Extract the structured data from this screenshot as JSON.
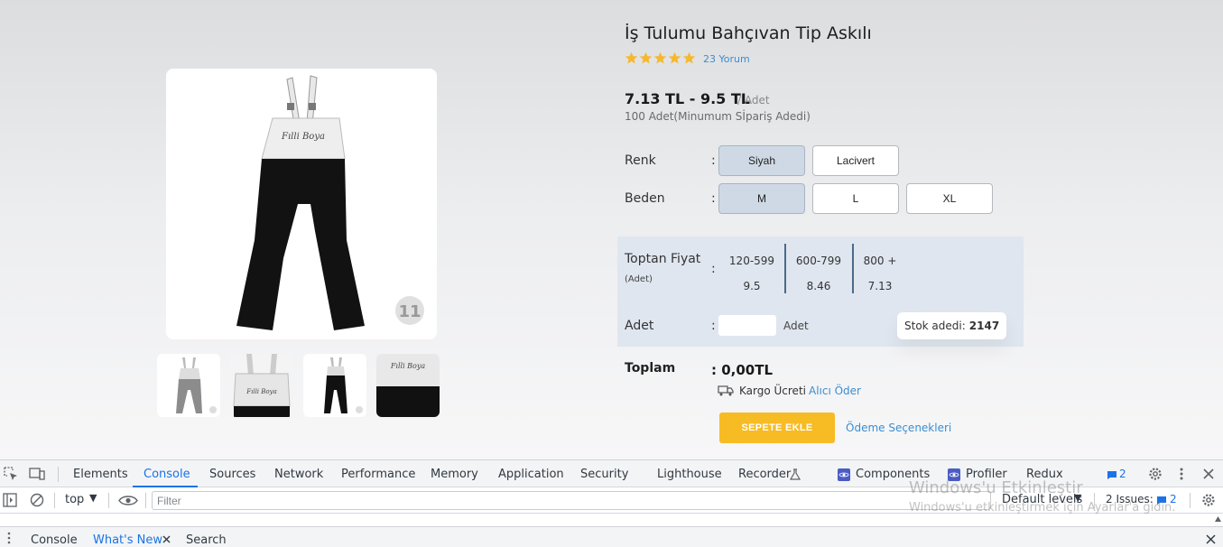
{
  "product": {
    "title": "İş Tulumu Bahçıvan Tip Askılı",
    "rating": 5,
    "review_text": "23 Yorum",
    "price_range": "7.13 TL - 9.5 TL",
    "price_unit": "/ Adet",
    "min_order": "100 Adet(Minumum Sİpariş Adedi)",
    "image_brand": "Fılli Boya",
    "image_badge": "11"
  },
  "options": {
    "color_label": "Renk",
    "size_label": "Beden",
    "colon": ":",
    "colors": [
      "Siyah",
      "Lacivert"
    ],
    "selected_color": "Siyah",
    "sizes": [
      "M",
      "L",
      "XL"
    ],
    "selected_size": "M"
  },
  "wholesale": {
    "label": "Toptan Fiyat",
    "sub_label": "(Adet)",
    "tiers": [
      {
        "range": "120-599",
        "price": "9.5"
      },
      {
        "range": "600-799",
        "price": "8.46"
      },
      {
        "range": "800 +",
        "price": "7.13"
      }
    ]
  },
  "quantity": {
    "label": "Adet",
    "unit": "Adet",
    "value": "",
    "stock_label": "Stok adedi:",
    "stock_value": "2147"
  },
  "total": {
    "label": "Toplam",
    "value": ": 0,00TL",
    "cargo_label": "Kargo Ücreti",
    "cargo_link": "Alıcı Öder"
  },
  "actions": {
    "add_to_cart": "SEPETE EKLE",
    "payment_options": "Ödeme Seçenekleri"
  },
  "colors": {
    "accent": "#f7bb24",
    "link": "#3b8ed0",
    "selected_option": "#cfd9e6",
    "devtools_active": "#1a73e8"
  },
  "devtools": {
    "tabs": [
      "Elements",
      "Console",
      "Sources",
      "Network",
      "Performance",
      "Memory",
      "Application",
      "Security",
      "Lighthouse",
      "Recorder",
      "Components",
      "Profiler",
      "Redux"
    ],
    "active_tab": "Console",
    "messages_count": "2",
    "context": "top",
    "filter_placeholder": "Filter",
    "levels": "Default levels",
    "issues_label": "2 Issues:",
    "issues_count": "2",
    "drawer_tabs": [
      "Console",
      "What's New",
      "Search"
    ],
    "drawer_active": "What's New"
  },
  "watermark": {
    "line1": "Windows'u Etkinleştir",
    "line2": "Windows'u etkinleştirmek için Ayarlar'a gidin."
  }
}
